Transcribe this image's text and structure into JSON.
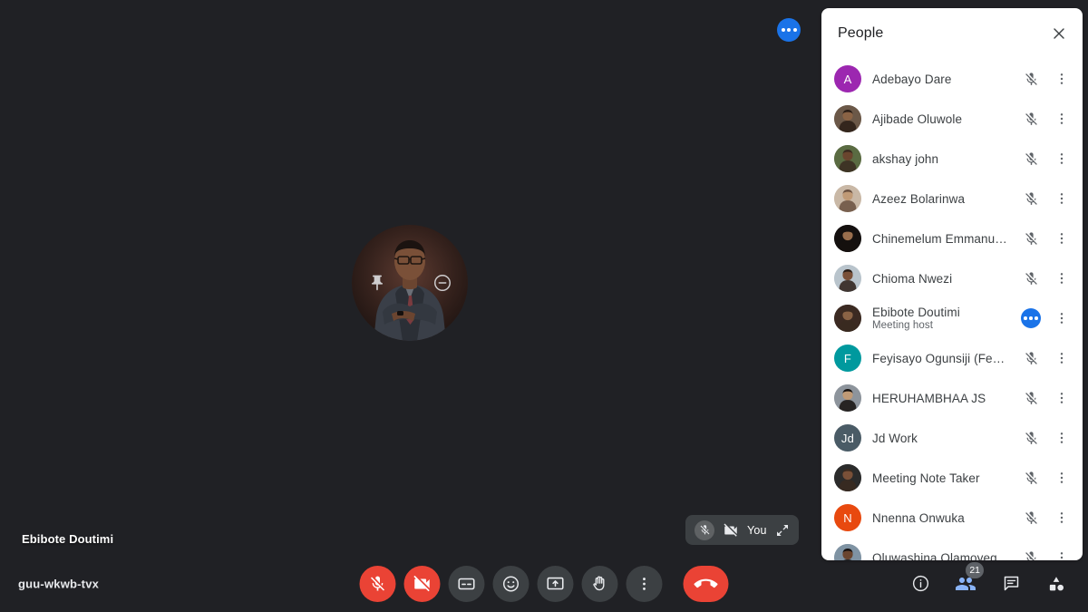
{
  "meeting": {
    "code": "guu-wkwb-tvx",
    "main_tile_name": "Ebibote Doutimi",
    "selfview_label": "You"
  },
  "colors": {
    "stage_bg": "#202125",
    "panel_bg": "#ffffff",
    "accent_blue": "#1a73e8",
    "danger_red": "#ea4335",
    "control_bg": "#3c4043",
    "badge_bg": "#5f6368"
  },
  "tile_hover": {
    "pin_icon": "pin-icon",
    "remove_icon": "minus-circle-icon"
  },
  "speaking_indicator": {
    "icon": "speaking-dots-icon"
  },
  "controls": {
    "mic": {
      "label": "Turn on microphone",
      "icon": "mic-off-icon",
      "state": "off"
    },
    "camera": {
      "label": "Turn on camera",
      "icon": "camera-off-icon",
      "state": "off"
    },
    "captions": {
      "label": "Turn on captions",
      "icon": "closed-captions-icon"
    },
    "emoji": {
      "label": "Send a reaction",
      "icon": "emoji-smiley-icon"
    },
    "present": {
      "label": "Present now",
      "icon": "present-screen-icon"
    },
    "hand": {
      "label": "Raise hand",
      "icon": "raise-hand-icon"
    },
    "more": {
      "label": "More options",
      "icon": "more-vertical-icon"
    },
    "hangup": {
      "label": "Leave call",
      "icon": "end-call-icon"
    }
  },
  "right_controls": {
    "info": {
      "label": "Meeting details",
      "icon": "info-icon"
    },
    "people": {
      "label": "People",
      "icon": "people-icon",
      "badge": "21",
      "active": true
    },
    "chat": {
      "label": "Chat with everyone",
      "icon": "chat-icon"
    },
    "activities": {
      "label": "Activities",
      "icon": "activities-icon"
    }
  },
  "panel": {
    "title": "People",
    "close_label": "Close",
    "close_icon": "close-icon",
    "mic_off_icon": "mic-off-icon",
    "more_icon": "more-vertical-icon",
    "participants": [
      {
        "name": "Adebayo Dare",
        "sub": "",
        "avatar_type": "initial",
        "initial": "A",
        "avatar_color": "#9c27b0",
        "status": "muted"
      },
      {
        "name": "Ajibade Oluwole",
        "sub": "",
        "avatar_type": "photo",
        "avatar_color": "#6b5848",
        "status": "muted"
      },
      {
        "name": "akshay john",
        "sub": "",
        "avatar_type": "photo",
        "avatar_color": "#5a6b42",
        "status": "muted"
      },
      {
        "name": "Azeez Bolarinwa",
        "sub": "",
        "avatar_type": "photo",
        "avatar_color": "#c9b8a6",
        "status": "muted"
      },
      {
        "name": "Chinemelum Emmanuel N...",
        "sub": "",
        "avatar_type": "photo",
        "avatar_color": "#14100f",
        "status": "muted"
      },
      {
        "name": "Chioma Nwezi",
        "sub": "",
        "avatar_type": "photo",
        "avatar_color": "#b9c4cc",
        "status": "muted"
      },
      {
        "name": "Ebibote Doutimi",
        "sub": "Meeting host",
        "avatar_type": "photo",
        "avatar_color": "#3b2a22",
        "status": "speaking"
      },
      {
        "name": "Feyisayo Ogunsiji (Feyish...",
        "sub": "",
        "avatar_type": "initial",
        "initial": "F",
        "avatar_color": "#00999e",
        "status": "muted"
      },
      {
        "name": "HERUHAMBHAA JS",
        "sub": "",
        "avatar_type": "photo",
        "avatar_color": "#8d949c",
        "status": "muted"
      },
      {
        "name": "Jd Work",
        "sub": "",
        "avatar_type": "initial",
        "initial": "Jd",
        "avatar_color": "#4a5b66",
        "status": "muted"
      },
      {
        "name": "Meeting Note Taker",
        "sub": "",
        "avatar_type": "photo",
        "avatar_color": "#2b2b2b",
        "status": "muted"
      },
      {
        "name": "Nnenna Onwuka",
        "sub": "",
        "avatar_type": "initial",
        "initial": "N",
        "avatar_color": "#e8490f",
        "status": "muted"
      },
      {
        "name": "Oluwashina Olamoyegun",
        "sub": "",
        "avatar_type": "photo",
        "avatar_color": "#7f93a3",
        "status": "muted"
      }
    ]
  }
}
